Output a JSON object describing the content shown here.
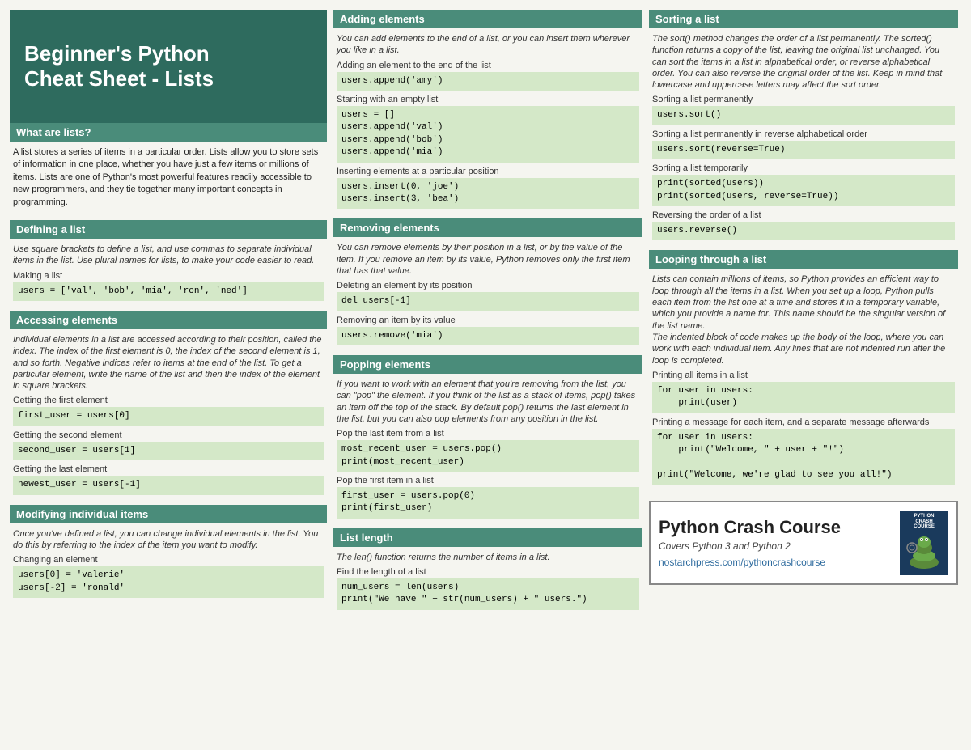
{
  "title": "Beginner's Python\nCheat Sheet - Lists",
  "col1": {
    "what_are_lists": {
      "header": "What are lists?",
      "text": "A list stores a series of items in a particular order. Lists allow you to store sets of information in one place, whether you have just a few items or millions of items. Lists are one of Python's most powerful features readily accessible to new programmers, and they tie together many important concepts in programming."
    },
    "defining": {
      "header": "Defining a list",
      "desc": "Use square brackets to define a list, and use commas to separate individual items in the list. Use plural names for lists, to make your code easier to read.",
      "subsections": [
        {
          "label": "Making a list",
          "code": "users = ['val', 'bob', 'mia', 'ron', 'ned']"
        }
      ]
    },
    "accessing": {
      "header": "Accessing elements",
      "desc": "Individual elements in a list are accessed according to their position, called the index. The index of the first element is 0, the index of the second element is 1, and so forth. Negative indices refer to items at the end of the list. To get a particular element, write the name of the list and then the index of the element in square brackets.",
      "subsections": [
        {
          "label": "Getting the first element",
          "code": "first_user = users[0]"
        },
        {
          "label": "Getting the second element",
          "code": "second_user = users[1]"
        },
        {
          "label": "Getting the last element",
          "code": "newest_user = users[-1]"
        }
      ]
    },
    "modifying": {
      "header": "Modifying individual items",
      "desc": "Once you've defined a list, you can change individual elements in the list. You do this by referring to the index of the item you want to modify.",
      "subsections": [
        {
          "label": "Changing an element",
          "code": "users[0] = 'valerie'\nusers[-2] = 'ronald'"
        }
      ]
    }
  },
  "col2": {
    "adding": {
      "header": "Adding elements",
      "desc": "You can add elements to the end of a list, or you can insert them wherever you like in a list.",
      "subsections": [
        {
          "label": "Adding an element to the end of the list",
          "code": "users.append('amy')"
        },
        {
          "label": "Starting with an empty list",
          "code": "users = []\nusers.append('val')\nusers.append('bob')\nusers.append('mia')"
        },
        {
          "label": "Inserting elements at a particular position",
          "code": "users.insert(0, 'joe')\nusers.insert(3, 'bea')"
        }
      ]
    },
    "removing": {
      "header": "Removing elements",
      "desc": "You can remove elements by their position in a list, or by the value of the item. If you remove an item by its value, Python removes only the first item that has that value.",
      "subsections": [
        {
          "label": "Deleting an element by its position",
          "code": "del users[-1]"
        },
        {
          "label": "Removing an item by its value",
          "code": "users.remove('mia')"
        }
      ]
    },
    "popping": {
      "header": "Popping elements",
      "desc": "If you want to work with an element that you're removing from the list, you can \"pop\" the element. If you think of the list as a stack of items, pop() takes an item off the top of the stack. By default pop() returns the last element in the list, but you can also pop elements from any position in the list.",
      "subsections": [
        {
          "label": "Pop the last item from a list",
          "code": "most_recent_user = users.pop()\nprint(most_recent_user)"
        },
        {
          "label": "Pop the first item in a list",
          "code": "first_user = users.pop(0)\nprint(first_user)"
        }
      ]
    },
    "list_length": {
      "header": "List length",
      "desc": "The len() function returns the number of items in a list.",
      "subsections": [
        {
          "label": "Find the length of a list",
          "code": "num_users = len(users)\nprint(\"We have \" + str(num_users) + \" users.\")"
        }
      ]
    }
  },
  "col3": {
    "sorting": {
      "header": "Sorting a list",
      "desc": "The sort() method changes the order of a list permanently. The sorted() function returns a copy of the list, leaving the original list unchanged. You can sort the items in a list in alphabetical order, or reverse alphabetical order. You can also reverse the original order of the list. Keep in mind that lowercase and uppercase letters may affect the sort order.",
      "subsections": [
        {
          "label": "Sorting a list permanently",
          "code": "users.sort()"
        },
        {
          "label": "Sorting a list permanently in reverse alphabetical order",
          "code": "users.sort(reverse=True)"
        },
        {
          "label": "Sorting a list temporarily",
          "code": "print(sorted(users))\nprint(sorted(users, reverse=True))"
        },
        {
          "label": "Reversing the order of a list",
          "code": "users.reverse()"
        }
      ]
    },
    "looping": {
      "header": "Looping through a list",
      "desc": "Lists can contain millions of items, so Python provides an efficient way to loop through all the items in a list. When you set up a loop, Python pulls each item from the list one at a time and stores it in a temporary variable, which you provide a name for. This name should be the singular version of the list name.\n    The indented block of code makes up the body of the loop, where you can work with each individual item. Any lines that are not indented run after the loop is completed.",
      "subsections": [
        {
          "label": "Printing all items in a list",
          "code": "for user in users:\n    print(user)"
        },
        {
          "label": "Printing a message for each item, and a separate message afterwards",
          "code": "for user in users:\n    print(\"Welcome, \" + user + \"!\")\n\nprint(\"Welcome, we're glad to see you all!\")"
        }
      ]
    },
    "promo": {
      "title": "Python Crash Course",
      "subtitle": "Covers Python 3 and Python 2",
      "link": "nostarchpress.com/pythoncrashcourse",
      "book_title": "PYTHON\nCRASH\nCOURSE"
    }
  }
}
